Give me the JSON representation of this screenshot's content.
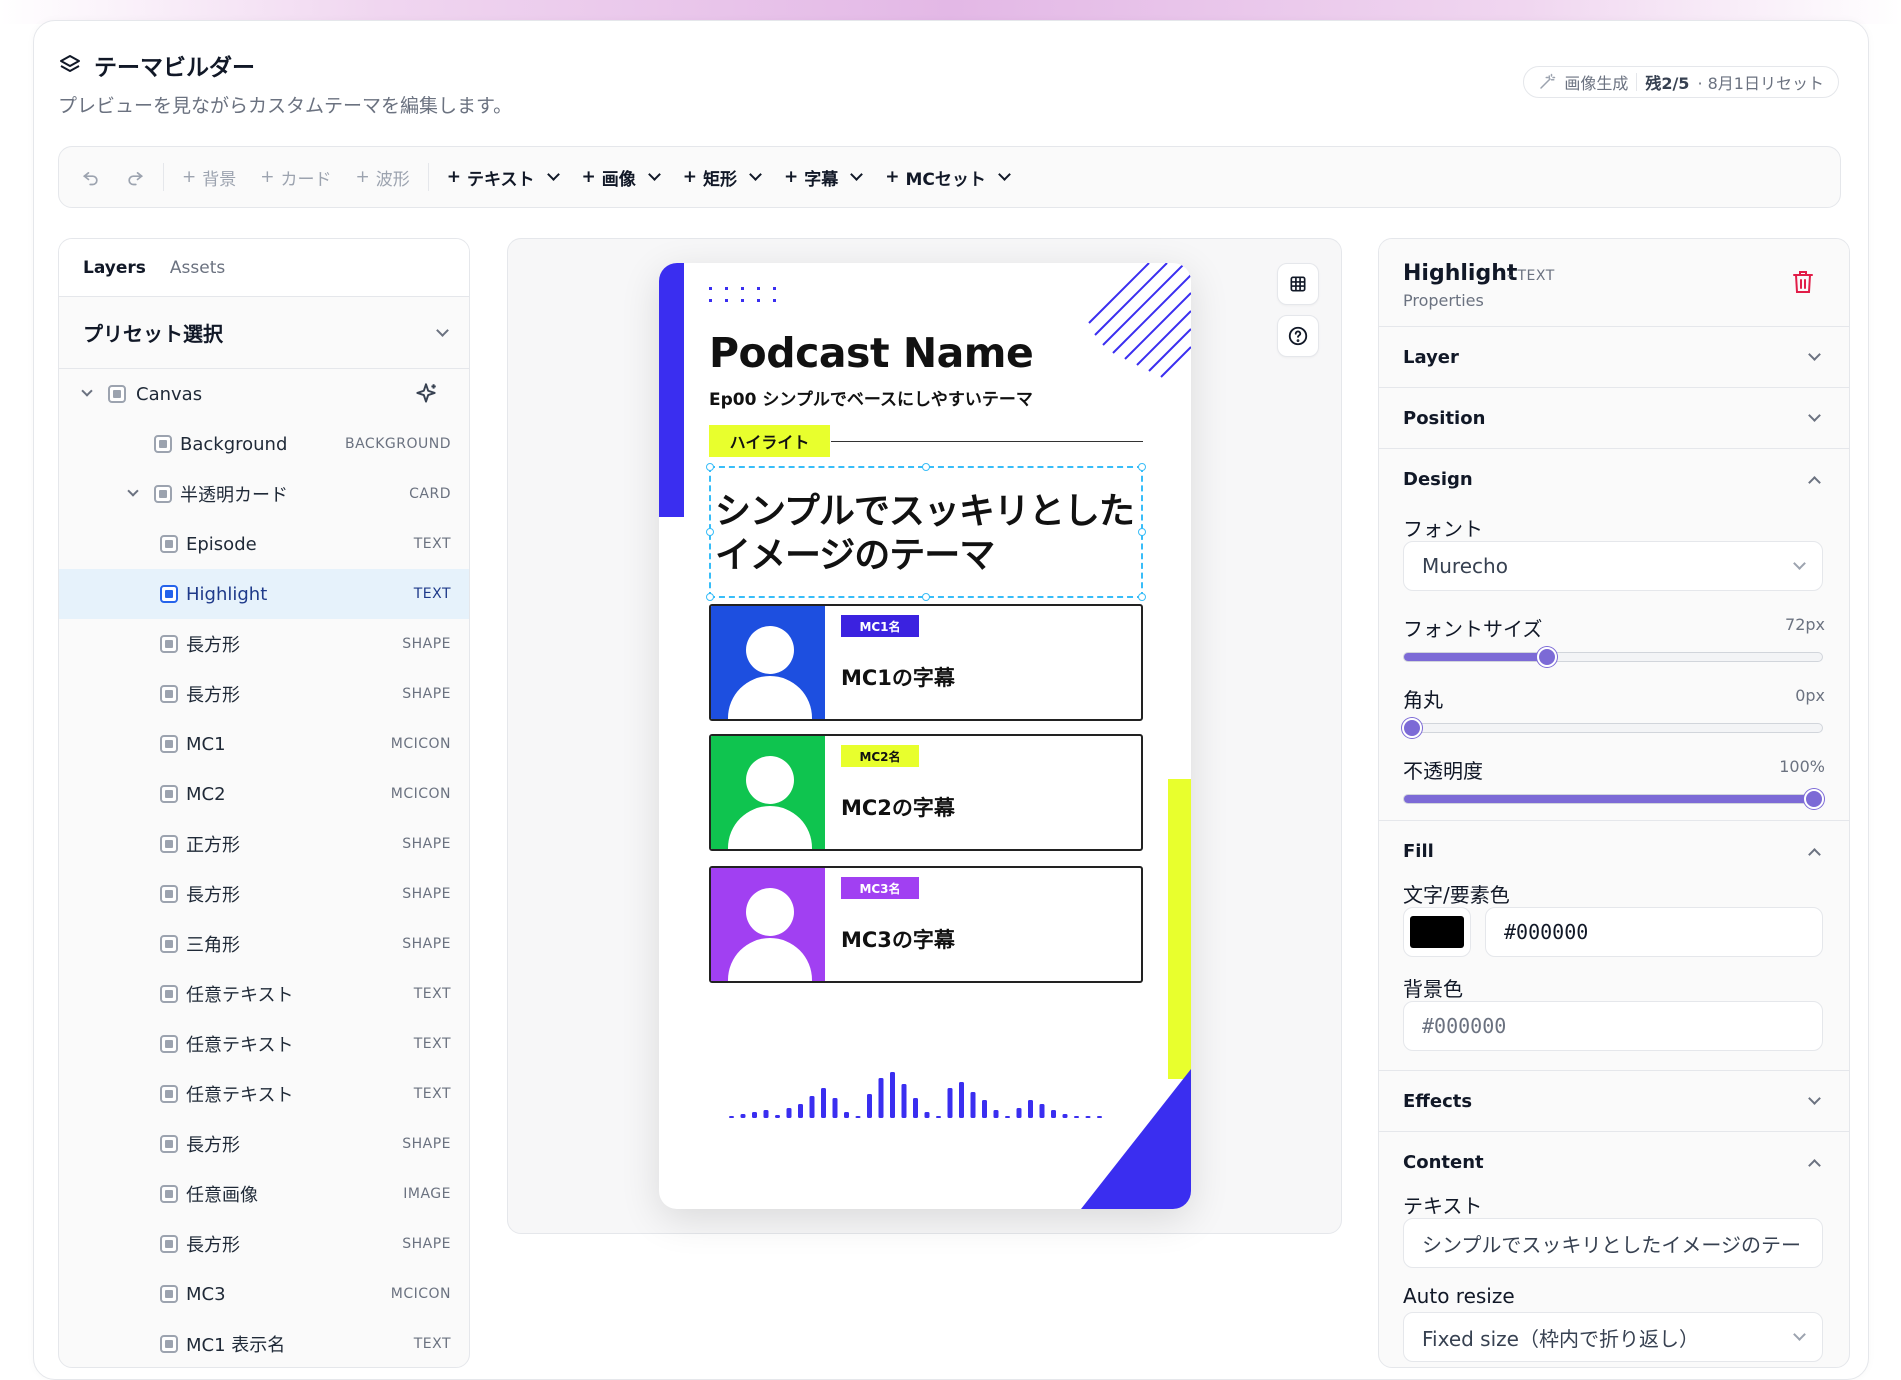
{
  "header": {
    "title": "テーマビルダー",
    "subtitle": "プレビューを見ながらカスタムテーマを編集します。",
    "usage": {
      "label": "画像生成",
      "remaining": "残2/5",
      "reset": "· 8月1日リセット"
    }
  },
  "toolbar": {
    "undo_icon": "undo-icon",
    "redo_icon": "redo-icon",
    "items": [
      {
        "label": "背景",
        "strong": false
      },
      {
        "label": "カード",
        "strong": false
      },
      {
        "label": "波形",
        "strong": false
      },
      {
        "label": "テキスト",
        "strong": true
      },
      {
        "label": "画像",
        "strong": true
      },
      {
        "label": "矩形",
        "strong": true
      },
      {
        "label": "字幕",
        "strong": true
      },
      {
        "label": "MCセット",
        "strong": true
      }
    ]
  },
  "left_panel": {
    "tabs": [
      "Layers",
      "Assets"
    ],
    "active_tab": "Layers",
    "preset_label": "プリセット選択",
    "canvas_label": "Canvas",
    "layers": [
      {
        "name": "Background",
        "type": "BACKGROUND"
      },
      {
        "name": "半透明カード",
        "type": "CARD"
      },
      {
        "name": "Episode",
        "type": "TEXT"
      },
      {
        "name": "Highlight",
        "type": "TEXT"
      },
      {
        "name": "長方形",
        "type": "SHAPE"
      },
      {
        "name": "長方形",
        "type": "SHAPE"
      },
      {
        "name": "MC1",
        "type": "MCICON"
      },
      {
        "name": "MC2",
        "type": "MCICON"
      },
      {
        "name": "正方形",
        "type": "SHAPE"
      },
      {
        "name": "長方形",
        "type": "SHAPE"
      },
      {
        "name": "三角形",
        "type": "SHAPE"
      },
      {
        "name": "任意テキスト",
        "type": "TEXT"
      },
      {
        "name": "任意テキスト",
        "type": "TEXT"
      },
      {
        "name": "任意テキスト",
        "type": "TEXT"
      },
      {
        "name": "長方形",
        "type": "SHAPE"
      },
      {
        "name": "任意画像",
        "type": "IMAGE"
      },
      {
        "name": "長方形",
        "type": "SHAPE"
      },
      {
        "name": "MC3",
        "type": "MCICON"
      },
      {
        "name": "MC1 表示名",
        "type": "TEXT"
      }
    ]
  },
  "preview": {
    "podcast_name": "Podcast Name",
    "episode": "Ep00 シンプルでベースにしやすいテーマ",
    "highlight_tag": "ハイライト",
    "highlight_text": "シンプルでスッキリとしたイメージのテーマ",
    "mcs": [
      {
        "badge": "MC1名",
        "subtitle": "MC1の字幕",
        "color": "#1d4fe0",
        "badge_bg": "#3b22e0",
        "badge_fg": "#ffffff"
      },
      {
        "badge": "MC2名",
        "subtitle": "MC2の字幕",
        "color": "#0fc44f",
        "badge_bg": "#e8ff2d",
        "badge_fg": "#111111"
      },
      {
        "badge": "MC3名",
        "subtitle": "MC3の字幕",
        "color": "#a140f2",
        "badge_bg": "#a140f2",
        "badge_fg": "#ffffff"
      }
    ],
    "waveform": [
      2,
      4,
      6,
      8,
      3,
      10,
      14,
      22,
      30,
      20,
      6,
      2,
      24,
      40,
      46,
      34,
      20,
      6,
      2,
      30,
      36,
      26,
      18,
      8,
      2,
      10,
      18,
      14,
      8,
      4,
      2,
      2,
      2
    ],
    "colors": {
      "accent_blue": "#3a2ef0",
      "accent_yellow": "#e8ff2d"
    },
    "tool_icons": [
      "grid-icon",
      "help-icon"
    ]
  },
  "right_panel": {
    "title": "Highlight",
    "kind": "- TEXT",
    "props_label": "Properties",
    "sections": {
      "layer": "Layer",
      "position": "Position",
      "design": "Design",
      "fill": "Fill",
      "effects": "Effects",
      "content": "Content"
    },
    "design": {
      "font_label": "フォント",
      "font_value": "Murecho",
      "size_label": "フォントサイズ",
      "size_value": "72px",
      "size_fraction": 0.34,
      "radius_label": "角丸",
      "radius_value": "0px",
      "radius_fraction": 0,
      "opacity_label": "不透明度",
      "opacity_value": "100%",
      "opacity_fraction": 1
    },
    "fill": {
      "text_color_label": "文字/要素色",
      "text_color_value": "#000000",
      "swatch": "#000000",
      "bg_label": "背景色",
      "bg_placeholder": "#000000"
    },
    "content": {
      "text_label": "テキスト",
      "text_value": "シンプルでスッキリとしたイメージのテー",
      "resize_label": "Auto resize",
      "resize_value": "Fixed size（枠内で折り返し）"
    }
  }
}
